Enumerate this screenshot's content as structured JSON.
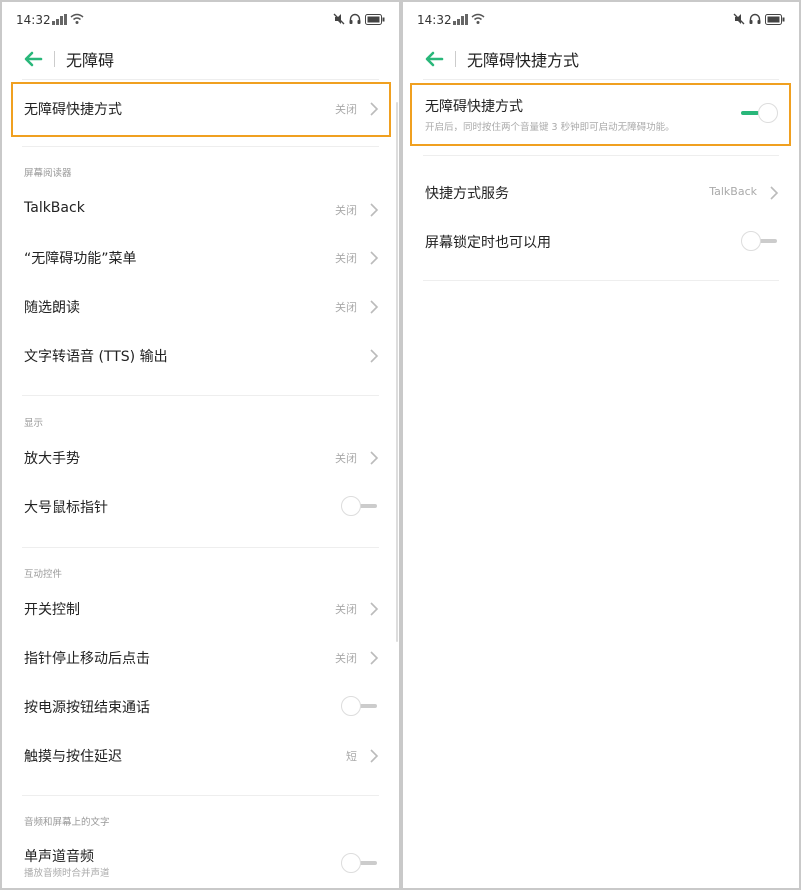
{
  "status_bar": {
    "time": "14:32"
  },
  "colors": {
    "accent": "#29b77a",
    "highlight": "#f0a020"
  },
  "left": {
    "title": "无障碍",
    "shortcut_row": {
      "label": "无障碍快捷方式",
      "value": "关闭"
    },
    "sections": {
      "screen_reader": "屏幕阅读器",
      "display": "显示",
      "interaction": "互动控件",
      "audio": "音频和屏幕上的文字"
    },
    "items": {
      "talkback": {
        "label": "TalkBack",
        "value": "关闭"
      },
      "a11y_menu": {
        "label": "“无障碍功能”菜单",
        "value": "关闭"
      },
      "select_to_speak": {
        "label": "随选朗读",
        "value": "关闭"
      },
      "tts": {
        "label": "文字转语音 (TTS) 输出"
      },
      "magnify": {
        "label": "放大手势",
        "value": "关闭"
      },
      "large_pointer": {
        "label": "大号鼠标指针"
      },
      "switch_access": {
        "label": "开关控制",
        "value": "关闭"
      },
      "dwell_click": {
        "label": "指针停止移动后点击",
        "value": "关闭"
      },
      "power_end_call": {
        "label": "按电源按钮结束通话"
      },
      "touch_delay": {
        "label": "触摸与按住延迟",
        "value": "短"
      },
      "mono_audio": {
        "label": "单声道音频",
        "sub": "播放音频时合并声道"
      }
    }
  },
  "right": {
    "title": "无障碍快捷方式",
    "shortcut_toggle": {
      "label": "无障碍快捷方式",
      "sub": "开启后，同时按住两个音量键 3 秒钟即可启动无障碍功能。",
      "on": true
    },
    "service": {
      "label": "快捷方式服务",
      "value": "TalkBack"
    },
    "lock_screen": {
      "label": "屏幕锁定时也可以用",
      "on": false
    }
  }
}
